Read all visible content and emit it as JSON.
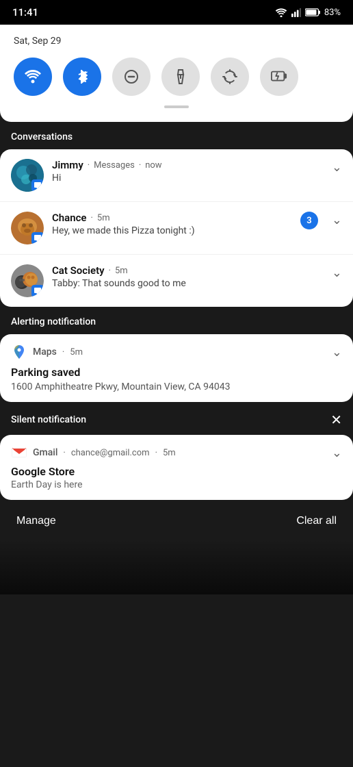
{
  "statusBar": {
    "time": "11:41",
    "battery": "83%"
  },
  "quickSettings": {
    "date": "Sat, Sep 29",
    "toggles": [
      {
        "id": "wifi",
        "label": "Wi-Fi",
        "active": true,
        "icon": "wifi"
      },
      {
        "id": "bluetooth",
        "label": "Bluetooth",
        "active": true,
        "icon": "bluetooth"
      },
      {
        "id": "dnd",
        "label": "Do Not Disturb",
        "active": false,
        "icon": "dnd"
      },
      {
        "id": "flashlight",
        "label": "Flashlight",
        "active": false,
        "icon": "flashlight"
      },
      {
        "id": "rotate",
        "label": "Auto-rotate",
        "active": false,
        "icon": "rotate"
      },
      {
        "id": "battery-saver",
        "label": "Battery Saver",
        "active": false,
        "icon": "battery-saver"
      }
    ]
  },
  "sections": {
    "conversations": {
      "label": "Conversations",
      "items": [
        {
          "sender": "Jimmy",
          "app": "Messages",
          "time": "now",
          "body": "Hi",
          "count": null
        },
        {
          "sender": "Chance",
          "app": "",
          "time": "5m",
          "body": "Hey, we made this Pizza tonight :)",
          "count": "3"
        },
        {
          "sender": "Cat Society",
          "app": "",
          "time": "5m",
          "body": "Tabby: That sounds good to me",
          "count": null
        }
      ]
    },
    "alerting": {
      "label": "Alerting notification",
      "app": "Maps",
      "time": "5m",
      "title": "Parking saved",
      "body": "1600 Amphitheatre Pkwy, Mountain View, CA 94043"
    },
    "silent": {
      "label": "Silent notification",
      "app": "Gmail",
      "email": "chance@gmail.com",
      "time": "5m",
      "title": "Google Store",
      "body": "Earth Day is here"
    }
  },
  "bottomBar": {
    "manage": "Manage",
    "clearAll": "Clear all"
  }
}
